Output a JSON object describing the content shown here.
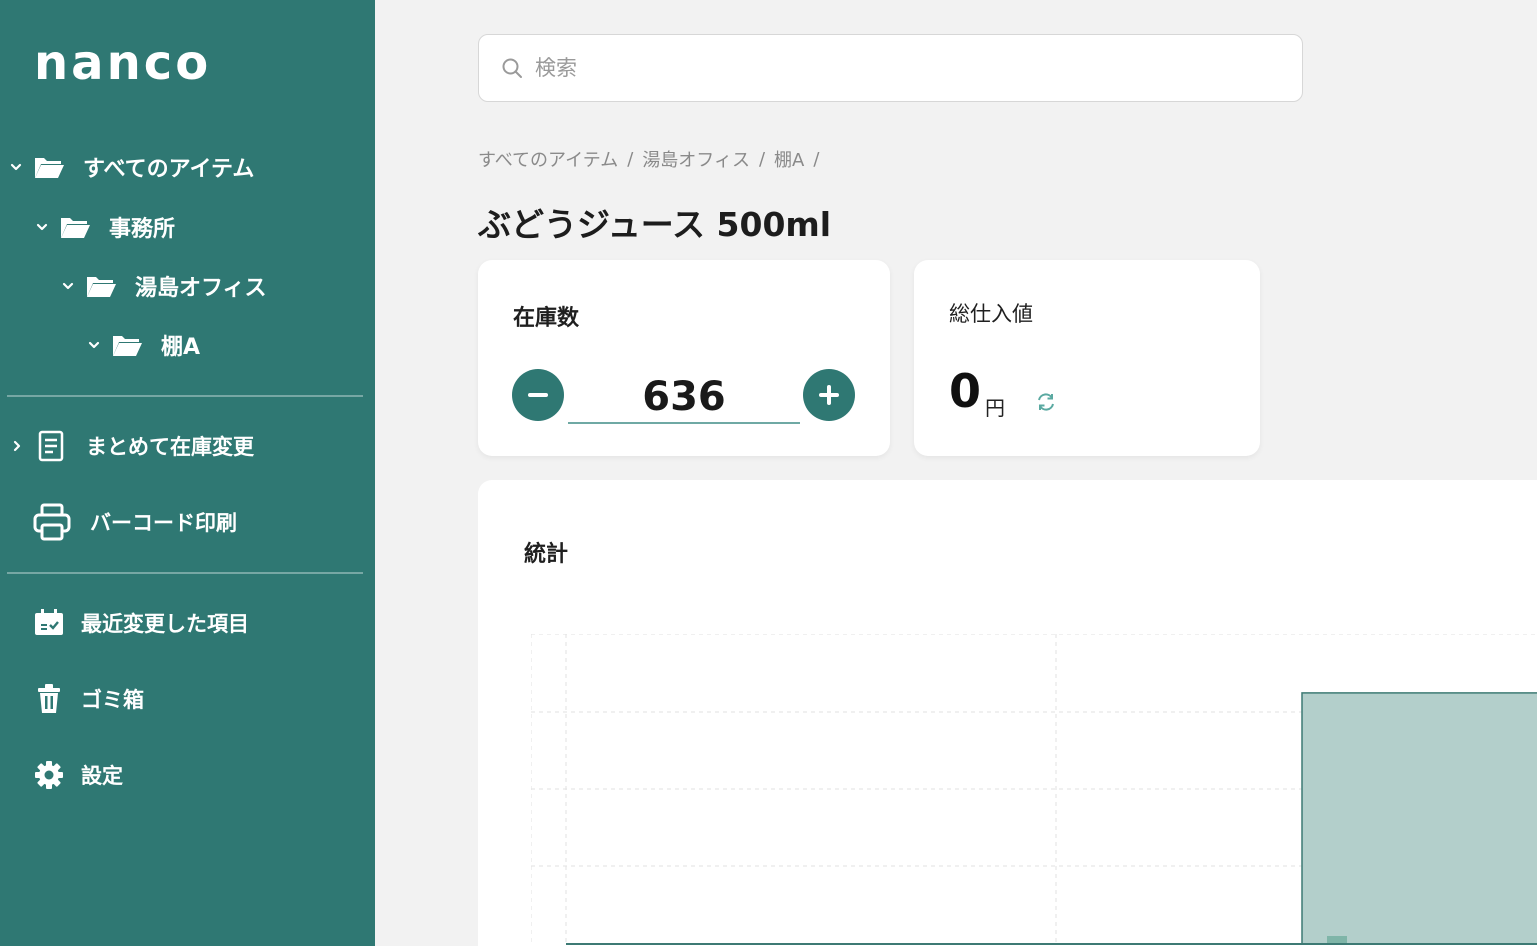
{
  "app": {
    "logo": "nanco"
  },
  "sidebar": {
    "tree": [
      {
        "label": "すべてのアイテム"
      },
      {
        "label": "事務所"
      },
      {
        "label": "湯島オフィス"
      },
      {
        "label": "棚A"
      }
    ],
    "actions": [
      {
        "label": "まとめて在庫変更",
        "icon": "document-icon"
      },
      {
        "label": "バーコード印刷",
        "icon": "printer-icon"
      }
    ],
    "nav": [
      {
        "label": "最近変更した項目",
        "icon": "calendar-check-icon"
      },
      {
        "label": "ゴミ箱",
        "icon": "trash-icon"
      },
      {
        "label": "設定",
        "icon": "gear-icon"
      }
    ]
  },
  "search": {
    "placeholder": "検索"
  },
  "breadcrumb": [
    "すべてのアイテム",
    "湯島オフィス",
    "棚A"
  ],
  "item": {
    "title": "ぶどうジュース 500ml"
  },
  "stock": {
    "title": "在庫数",
    "value": "636"
  },
  "cost": {
    "title": "総仕入値",
    "value": "0",
    "unit": "円"
  },
  "stats": {
    "title": "統計",
    "bar_value_fraction": 0.81
  },
  "colors": {
    "sidebar_bg": "#2f7873",
    "accent": "#2f7873",
    "bar_fill": "#b3cfcb",
    "refresh_icon": "#5aa9a1"
  }
}
